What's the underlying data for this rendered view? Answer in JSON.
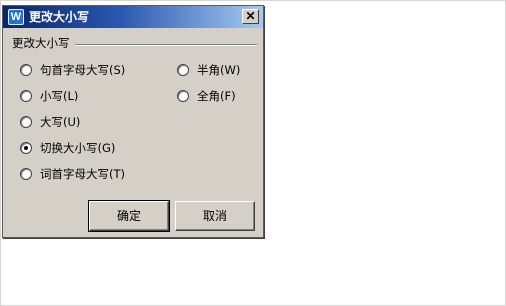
{
  "window": {
    "title": "更改大小写",
    "icon": "W",
    "close_glyph": "✕"
  },
  "group": {
    "label": "更改大小写"
  },
  "options_left": [
    {
      "label": "句首字母大写(S)",
      "checked": false
    },
    {
      "label": "小写(L)",
      "checked": false
    },
    {
      "label": "大写(U)",
      "checked": false
    },
    {
      "label": "切换大小写(G)",
      "checked": true
    },
    {
      "label": "词首字母大写(T)",
      "checked": false
    }
  ],
  "options_right": [
    {
      "label": "半角(W)",
      "checked": false
    },
    {
      "label": "全角(F)",
      "checked": false
    }
  ],
  "buttons": {
    "ok": "确定",
    "cancel": "取消"
  }
}
